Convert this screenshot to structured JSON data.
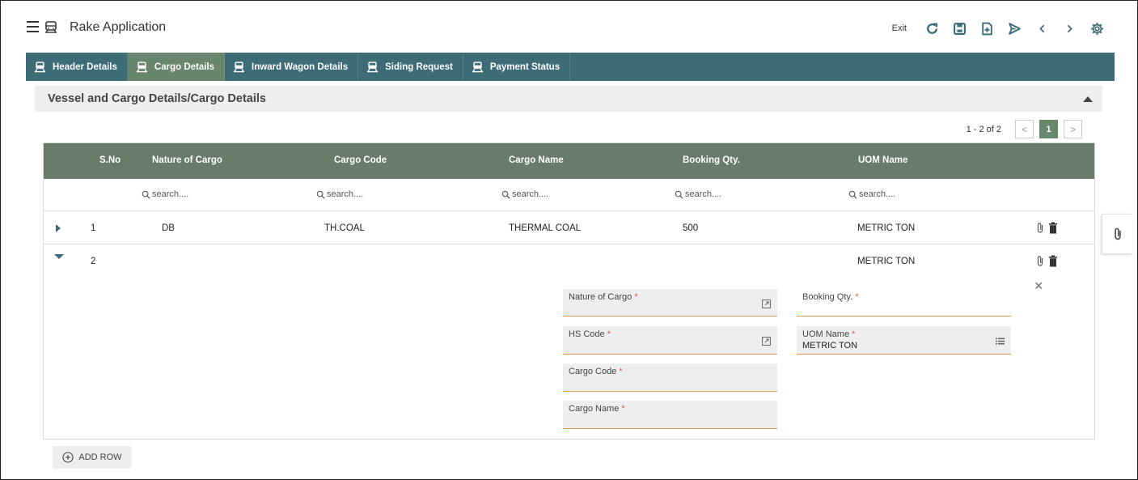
{
  "app": {
    "title": "Rake Application"
  },
  "toolbar": {
    "exit_label": "Exit",
    "icons": [
      "refresh-icon",
      "save-icon",
      "new-document-icon",
      "send-icon",
      "previous-icon",
      "next-icon",
      "settings-icon"
    ],
    "accent_color": "#3d6b76"
  },
  "tabs": [
    {
      "label": "Header Details",
      "active": false
    },
    {
      "label": "Cargo Details",
      "active": true
    },
    {
      "label": "Inward Wagon Details",
      "active": false
    },
    {
      "label": "Siding Request",
      "active": false
    },
    {
      "label": "Payment Status",
      "active": false
    }
  ],
  "section": {
    "title": "Vessel and Cargo Details/Cargo Details"
  },
  "pager": {
    "info": "1 - 2 of 2",
    "prev": "<",
    "page": "1",
    "next": ">"
  },
  "table": {
    "columns": [
      "S.No",
      "Nature of Cargo",
      "Cargo Code",
      "Cargo Name",
      "Booking Qty.",
      "UOM Name"
    ],
    "filter_placeholder": "search....",
    "rows": [
      {
        "sno": "1",
        "nature": "DB",
        "code": "TH.COAL",
        "name": "THERMAL COAL",
        "qty": "500",
        "uom": "METRIC TON",
        "expanded": false
      },
      {
        "sno": "2",
        "nature": "",
        "code": "",
        "name": "",
        "qty": "",
        "uom": "METRIC TON",
        "expanded": true
      }
    ]
  },
  "form": {
    "nature_label": "Nature of Cargo",
    "booking_label": "Booking Qty.",
    "hs_label": "HS Code",
    "uom_label": "UOM Name",
    "uom_value": "METRIC TON",
    "code_label": "Cargo Code",
    "name_label": "Cargo Name",
    "required_mark": "*",
    "close": "×"
  },
  "actions": {
    "add_row": "ADD ROW"
  },
  "colors": {
    "header_bg": "#3d6b76",
    "active_tab": "#69856c",
    "table_header": "#677d6a",
    "field_underline": "#e09a4a"
  }
}
